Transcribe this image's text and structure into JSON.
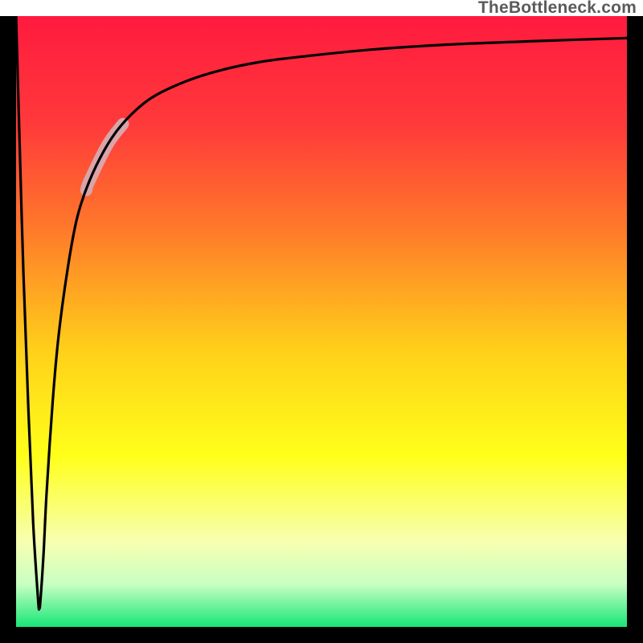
{
  "watermark": "TheBottleneck.com",
  "gradient": {
    "stops": [
      {
        "offset": 0.0,
        "color": "#ff1a3f"
      },
      {
        "offset": 0.18,
        "color": "#ff3a3a"
      },
      {
        "offset": 0.35,
        "color": "#ff7a2a"
      },
      {
        "offset": 0.55,
        "color": "#ffd11a"
      },
      {
        "offset": 0.72,
        "color": "#ffff1a"
      },
      {
        "offset": 0.86,
        "color": "#f7ffb0"
      },
      {
        "offset": 0.93,
        "color": "#c8ffc3"
      },
      {
        "offset": 1.0,
        "color": "#17e676"
      }
    ]
  },
  "chart_data": {
    "type": "line",
    "title": "",
    "xlabel": "",
    "ylabel": "",
    "xlim": [
      0,
      100
    ],
    "ylim": [
      0,
      100
    ],
    "legend": false,
    "grid": false,
    "series": [
      {
        "name": "bottleneck-curve",
        "x": [
          0.0,
          0.5,
          1.2,
          2.0,
          2.8,
          3.6,
          3.8,
          4.0,
          4.5,
          5.0,
          6.0,
          7.0,
          8.5,
          10.0,
          12.0,
          15.0,
          18.0,
          22.0,
          27.0,
          33.0,
          40.0,
          48.0,
          58.0,
          70.0,
          85.0,
          100.0
        ],
        "values": [
          100.0,
          82.0,
          58.0,
          36.0,
          17.0,
          4.5,
          3.0,
          4.5,
          12.0,
          22.0,
          37.0,
          48.0,
          59.0,
          67.0,
          73.0,
          79.0,
          83.0,
          86.5,
          89.0,
          91.0,
          92.5,
          93.5,
          94.5,
          95.3,
          95.9,
          96.4
        ]
      }
    ],
    "highlight": {
      "x_range": [
        11.5,
        17.5
      ],
      "note": "soft-pink segment on rising branch"
    },
    "optimum": {
      "x": 3.8,
      "value": 3.0
    }
  }
}
